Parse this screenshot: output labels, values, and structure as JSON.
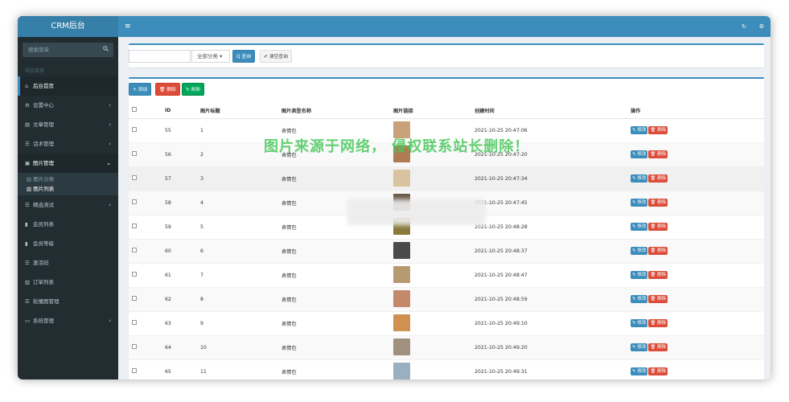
{
  "app": {
    "title": "CRM后台"
  },
  "sidebar": {
    "search_placeholder": "搜索菜单",
    "nav_header": "导航菜单",
    "items": [
      {
        "label": "后台首页",
        "icon": "home-icon",
        "arrow": ""
      },
      {
        "label": "设置中心",
        "icon": "cogs-icon",
        "arrow": "‹"
      },
      {
        "label": "文章管理",
        "icon": "file-icon",
        "arrow": "‹"
      },
      {
        "label": "话术管理",
        "icon": "list-icon",
        "arrow": "‹"
      },
      {
        "label": "图片管理",
        "icon": "image-icon",
        "arrow": "⌄"
      },
      {
        "label": "精选测试",
        "icon": "list-icon",
        "arrow": "‹"
      },
      {
        "label": "会员列表",
        "icon": "book-icon",
        "arrow": ""
      },
      {
        "label": "会员等级",
        "icon": "book-icon",
        "arrow": ""
      },
      {
        "label": "激活码",
        "icon": "list-icon",
        "arrow": ""
      },
      {
        "label": "订单列表",
        "icon": "chart-icon",
        "arrow": ""
      },
      {
        "label": "轮播图管理",
        "icon": "list-icon",
        "arrow": ""
      },
      {
        "label": "系统管理",
        "icon": "desktop-icon",
        "arrow": "‹"
      }
    ],
    "submenu": [
      {
        "label": "图片分类"
      },
      {
        "label": "图片列表"
      }
    ]
  },
  "filter": {
    "category_select": "全部分类 ▾",
    "search_button": "Q 查询",
    "clear_button": "✐ 清空查询"
  },
  "toolbar": {
    "add_button": "+ 添加",
    "delete_button": "🗑 删除",
    "refresh_button": "↻ 刷新"
  },
  "table": {
    "headers": [
      "ID",
      "图片标题",
      "图片类型名称",
      "图片链接",
      "创建时间",
      "操作"
    ],
    "rows": [
      {
        "id": "55",
        "title": "1",
        "type": "表情包",
        "time": "2021-10-25 20:47:06",
        "thumb_color": "#c9a27a"
      },
      {
        "id": "56",
        "title": "2",
        "type": "表情包",
        "time": "2021-10-25 20:47:20",
        "thumb_color": "#b07a52"
      },
      {
        "id": "57",
        "title": "3",
        "type": "表情包",
        "time": "2021-10-25 20:47:34",
        "thumb_color": "#d8c2a0"
      },
      {
        "id": "58",
        "title": "4",
        "type": "表情包",
        "time": "2021-10-25 20:47:45",
        "thumb_color": "#6b5a4a"
      },
      {
        "id": "59",
        "title": "5",
        "type": "表情包",
        "time": "2021-10-25 20:48:28",
        "thumb_color": "#8a7a3a"
      },
      {
        "id": "60",
        "title": "6",
        "type": "表情包",
        "time": "2021-10-25 20:48:37",
        "thumb_color": "#4a4a4a"
      },
      {
        "id": "61",
        "title": "7",
        "type": "表情包",
        "time": "2021-10-25 20:48:47",
        "thumb_color": "#b89a70"
      },
      {
        "id": "62",
        "title": "8",
        "type": "表情包",
        "time": "2021-10-25 20:48:59",
        "thumb_color": "#c4896a"
      },
      {
        "id": "63",
        "title": "9",
        "type": "表情包",
        "time": "2021-10-25 20:49:10",
        "thumb_color": "#d09050"
      },
      {
        "id": "64",
        "title": "10",
        "type": "表情包",
        "time": "2021-10-25 20:49:20",
        "thumb_color": "#a09080"
      },
      {
        "id": "65",
        "title": "11",
        "type": "表情包",
        "time": "2021-10-25 20:49:31",
        "thumb_color": "#9ab0c0"
      }
    ],
    "edit_label": "✎ 修改",
    "delete_label": "🗑 删除"
  },
  "watermark": "图片来源于网络， 侵权联系站长删除！",
  "colors": {
    "primary": "#3c8dbc",
    "danger": "#dd4b39",
    "success": "#00a65a",
    "sidebar": "#222d32"
  }
}
